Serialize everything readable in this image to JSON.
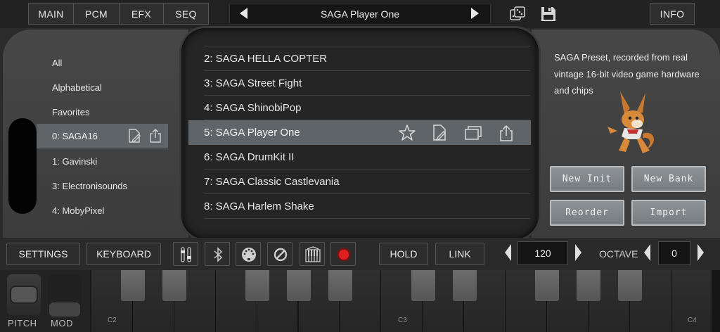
{
  "tabs": [
    "MAIN",
    "PCM",
    "EFX",
    "SEQ"
  ],
  "preset_bar": {
    "name": "SAGA Player One"
  },
  "top_icons": {
    "dice": "dice-icon",
    "save": "floppy-disk-icon"
  },
  "info_label": "INFO",
  "categories": [
    "All",
    "Alphabetical",
    "Favorites"
  ],
  "banks": {
    "selected": "0: SAGA16",
    "items": [
      "1: Gavinski",
      "3: Electronisounds",
      "4: MobyPixel"
    ]
  },
  "presets": {
    "items": [
      "2: SAGA HELLA COPTER",
      "3: SAGA Street Fight",
      "4: SAGA ShinobiPop",
      "6: SAGA DrumKit II",
      "7: SAGA Classic Castlevania",
      "8: SAGA Harlem Shake"
    ],
    "selected": "5: SAGA Player One"
  },
  "description": "SAGA Preset, recorded from real vintage 16-bit video game hardware and chips",
  "right_buttons": {
    "new_init": "New Init",
    "new_bank": "New Bank",
    "reorder": "Reorder",
    "import": "Import"
  },
  "controls": {
    "settings": "SETTINGS",
    "keyboard": "KEYBOARD",
    "hold": "HOLD",
    "link": "LINK",
    "tempo": "120",
    "octave_label": "OCTAVE",
    "octave": "0"
  },
  "wheels": {
    "pitch": "PITCH",
    "mod": "MOD"
  },
  "notes": [
    "C2",
    "C3",
    "C4"
  ],
  "colors": {
    "selected_row": "#5f6468",
    "record": "#e02020",
    "button": "#8d9296"
  }
}
